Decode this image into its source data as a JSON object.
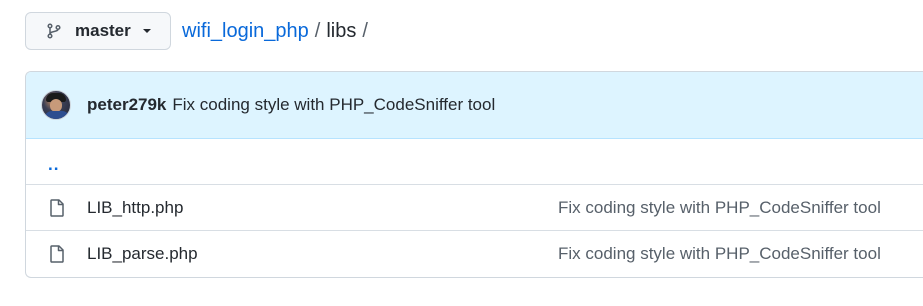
{
  "branch": {
    "name": "master",
    "icon": "git-branch-icon",
    "caret_icon": "triangle-down-icon"
  },
  "breadcrumb": {
    "repo": "wifi_login_php",
    "separator": "/",
    "current": "libs",
    "trailing": "/"
  },
  "latest_commit": {
    "author": "peter279k",
    "message": "Fix coding style with PHP_CodeSniffer tool",
    "avatar": "avatar-image"
  },
  "parent_dir": {
    "label": ".."
  },
  "files": [
    {
      "name": "LIB_http.php",
      "icon": "file-icon",
      "commit_message": "Fix coding style with PHP_CodeSniffer tool"
    },
    {
      "name": "LIB_parse.php",
      "icon": "file-icon",
      "commit_message": "Fix coding style with PHP_CodeSniffer tool"
    }
  ],
  "colors": {
    "link": "#0969da",
    "commit_bg": "#ddf4ff",
    "border": "#d0d7de"
  }
}
